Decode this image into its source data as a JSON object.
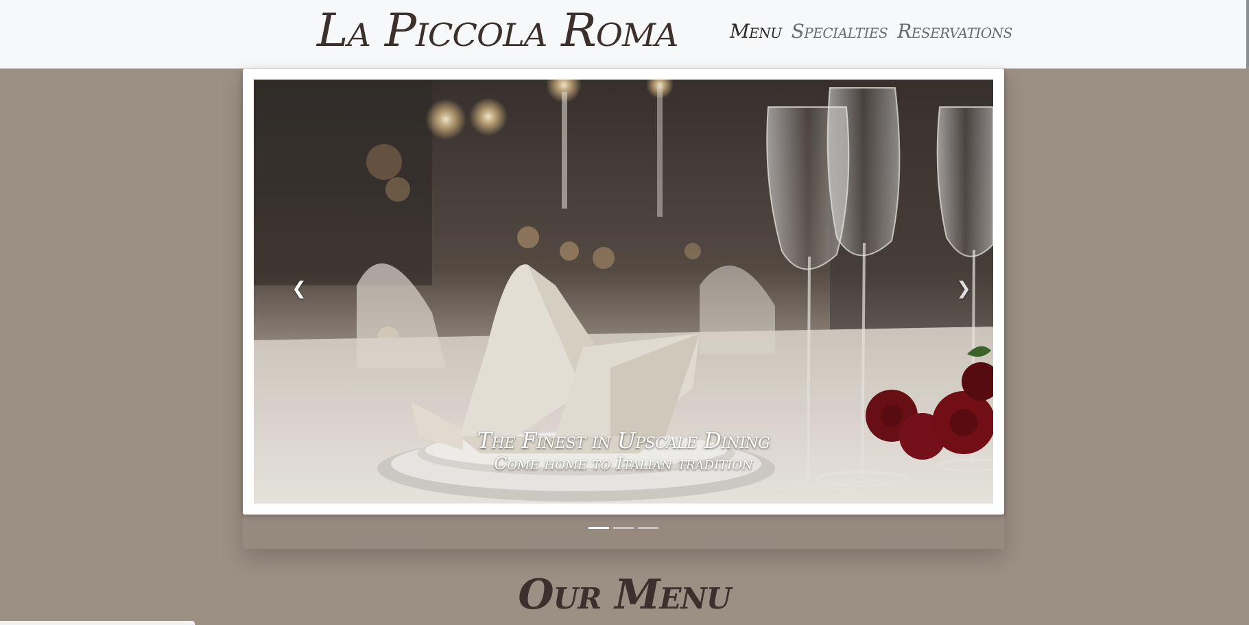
{
  "brand": {
    "name": "La Piccola Roma"
  },
  "nav": {
    "links": [
      {
        "label": "Menu",
        "active": true
      },
      {
        "label": "Specialties",
        "active": false
      },
      {
        "label": "Reservations",
        "active": false
      }
    ]
  },
  "carousel": {
    "caption_title": "The Finest in Upscale Dining",
    "caption_subtitle": "Come home to Italian tradition",
    "prev_icon": "chevron-left-icon",
    "next_icon": "chevron-right-icon",
    "prev_glyph": "❮",
    "next_glyph": "❯",
    "slides": 3,
    "active_slide": 1
  },
  "section": {
    "title": "Our Menu"
  },
  "colors": {
    "page_background": "#9c8f84",
    "navbar_background": "#f7f8fa",
    "brand_text": "#3b302b",
    "nav_inactive": "#6b6b6b",
    "nav_active": "#2f2a27"
  }
}
